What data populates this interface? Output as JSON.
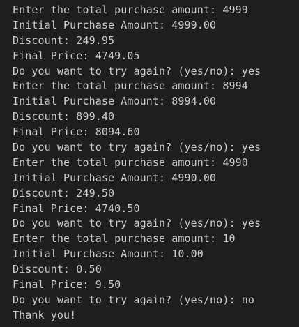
{
  "terminal": {
    "lines": [
      "Enter the total purchase amount: 4999",
      "Initial Purchase Amount: 4999.00",
      "Discount: 249.95",
      "Final Price: 4749.05",
      "Do you want to try again? (yes/no): yes",
      "Enter the total purchase amount: 8994",
      "Initial Purchase Amount: 8994.00",
      "Discount: 899.40",
      "Final Price: 8094.60",
      "Do you want to try again? (yes/no): yes",
      "Enter the total purchase amount: 4990",
      "Initial Purchase Amount: 4990.00",
      "Discount: 249.50",
      "Final Price: 4740.50",
      "Do you want to try again? (yes/no): yes",
      "Enter the total purchase amount: 10",
      "Initial Purchase Amount: 10.00",
      "Discount: 0.50",
      "Final Price: 9.50",
      "Do you want to try again? (yes/no): no",
      "Thank you!"
    ],
    "colors": {
      "background": "#1e1e1e",
      "text": "#cccccc"
    }
  }
}
